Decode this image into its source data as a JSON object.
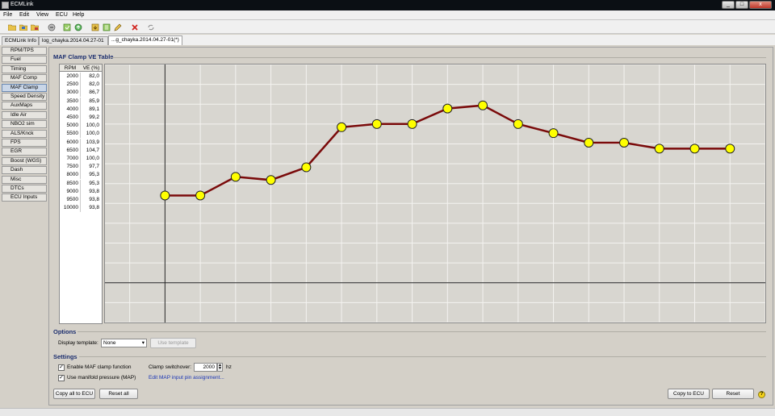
{
  "window": {
    "title": "ECMLink",
    "min": "_",
    "max": "□",
    "close": "x"
  },
  "menu": [
    "File",
    "Edit",
    "View",
    "ECU",
    "Help"
  ],
  "toolbar": [
    "open-icon",
    "save-icon",
    "save-as-icon",
    "connect-icon",
    "refresh-icon",
    "upload-icon",
    "download-icon",
    "compare-icon",
    "edit-icon",
    "delete-icon",
    "sync-icon"
  ],
  "tabs": [
    "ECMLink Info",
    "log_chayka.2014.04.27-01",
    "...g_chayka.2014.04.27-01(*)"
  ],
  "sidebar": [
    {
      "label": "RPM/TPS",
      "active": false
    },
    {
      "label": "Fuel",
      "active": false
    },
    {
      "label": "Timing",
      "active": false
    },
    {
      "label": "MAF Comp",
      "active": false
    },
    {
      "label": "MAF Clamp",
      "active": true
    },
    {
      "label": "Speed Density",
      "active": false
    },
    {
      "label": "AuxMaps",
      "active": false
    },
    {
      "label": "Idle Air",
      "active": false
    },
    {
      "label": "NBO2 sim",
      "active": false
    },
    {
      "label": "ALS/Knck",
      "active": false
    },
    {
      "label": "FPS",
      "active": false
    },
    {
      "label": "EGR",
      "active": false
    },
    {
      "label": "Boost (WGS)",
      "active": false
    },
    {
      "label": "Dash",
      "active": false
    },
    {
      "label": "Misc",
      "active": false
    },
    {
      "label": "DTCs",
      "active": false
    },
    {
      "label": "ECU Inputs",
      "active": false
    }
  ],
  "section_title": "MAF Clamp VE Table",
  "table": {
    "headers": [
      "RPM",
      "VE (%)"
    ],
    "rows": [
      [
        "2000",
        "82,0"
      ],
      [
        "2500",
        "82,0"
      ],
      [
        "3000",
        "86,7"
      ],
      [
        "3500",
        "85,9"
      ],
      [
        "4000",
        "89,1"
      ],
      [
        "4500",
        "99,2"
      ],
      [
        "5000",
        "100,0"
      ],
      [
        "5500",
        "100,0"
      ],
      [
        "6000",
        "103,9"
      ],
      [
        "6500",
        "104,7"
      ],
      [
        "7000",
        "100,0"
      ],
      [
        "7500",
        "97,7"
      ],
      [
        "8000",
        "95,3"
      ],
      [
        "8500",
        "95,3"
      ],
      [
        "9000",
        "93,8"
      ],
      [
        "9500",
        "93,8"
      ],
      [
        "10000",
        "93,8"
      ]
    ]
  },
  "chart_data": {
    "type": "line",
    "x": [
      2000,
      2500,
      3000,
      3500,
      4000,
      4500,
      5000,
      5500,
      6000,
      6500,
      7000,
      7500,
      8000,
      8500,
      9000,
      9500,
      10000
    ],
    "series": [
      {
        "values": [
          82.0,
          82.0,
          86.7,
          85.9,
          89.1,
          99.2,
          100.0,
          100.0,
          103.9,
          104.7,
          100.0,
          97.7,
          95.3,
          95.3,
          93.8,
          93.8,
          93.8
        ]
      }
    ],
    "xlim": [
      1150,
      10500
    ],
    "ylim": [
      50,
      115
    ],
    "grid": true,
    "line_color": "#7a0a0a",
    "marker_color": "#ffff00"
  },
  "options": {
    "title": "Options",
    "template_label": "Display template:",
    "template_value": "None",
    "use_template": "Use template"
  },
  "settings": {
    "title": "Settings",
    "enable_clamp": "Enable MAF clamp function",
    "enable_clamp_checked": true,
    "use_map": "Use manifold pressure (MAP)",
    "use_map_checked": true,
    "switchover_label": "Clamp switchover:",
    "switchover_value": "2000",
    "switchover_unit": "hz",
    "edit_map_link": "Edit MAP input pin assignment..."
  },
  "buttons": {
    "copy_all": "Copy all to ECU",
    "reset_all": "Reset all",
    "copy_to_ecu": "Copy to ECU",
    "reset": "Reset",
    "help": "?"
  }
}
